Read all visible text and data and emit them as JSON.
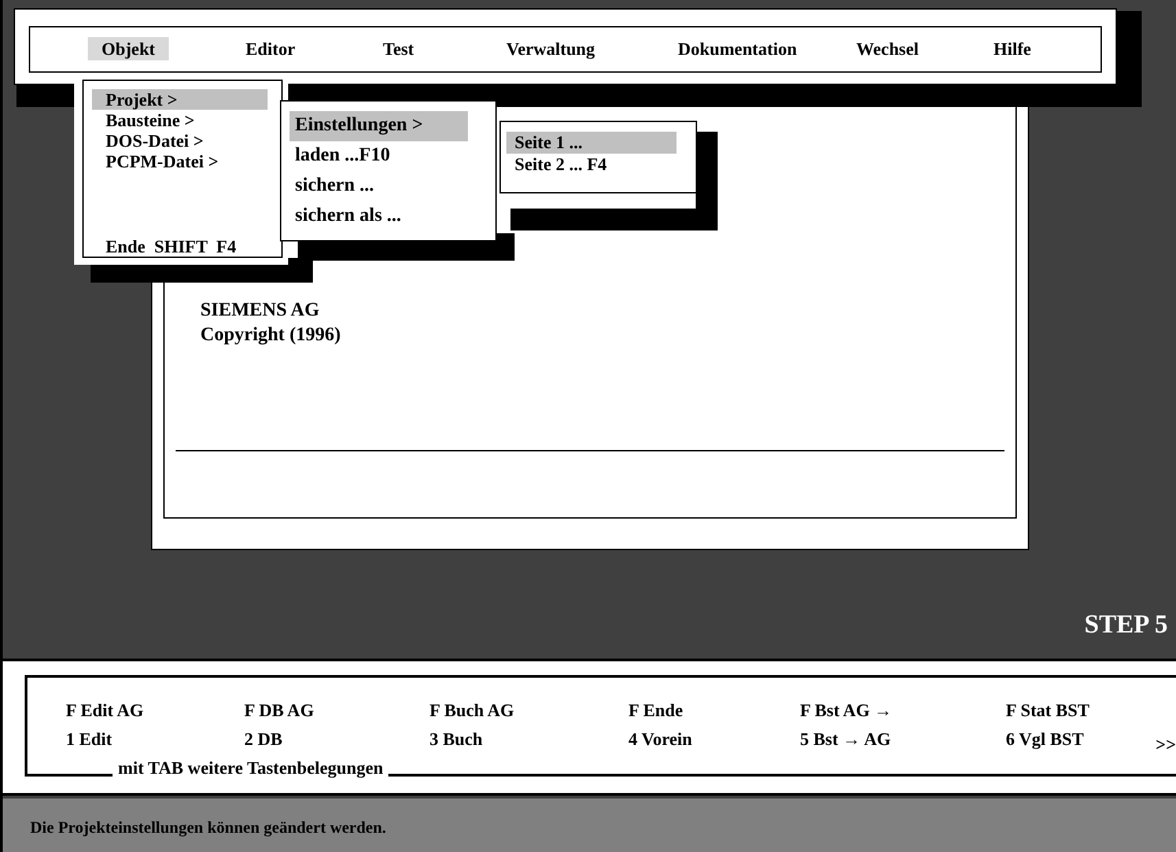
{
  "menu_bar": {
    "items": [
      {
        "label": "Objekt",
        "selected": true
      },
      {
        "label": "Editor",
        "selected": false
      },
      {
        "label": "Test",
        "selected": false
      },
      {
        "label": "Verwaltung",
        "selected": false
      },
      {
        "label": "Dokumentation",
        "selected": false
      },
      {
        "label": "Wechsel",
        "selected": false
      },
      {
        "label": "Hilfe",
        "selected": false
      }
    ]
  },
  "menus": [
    {
      "items": [
        {
          "label": "Projekt >",
          "selected": true
        },
        {
          "label": "Bausteine >",
          "selected": false
        },
        {
          "label": "DOS-Datei >",
          "selected": false
        },
        {
          "label": "PCPM-Datei >",
          "selected": false
        },
        {
          "label": "Ende  SHIFT  F4",
          "selected": false,
          "kind": "bottom"
        }
      ]
    },
    {
      "items": [
        {
          "label": "Einstellungen >",
          "selected": true
        },
        {
          "label": "laden ...F10",
          "selected": false
        },
        {
          "label": "sichern ...",
          "selected": false
        },
        {
          "label": "sichern als ...",
          "selected": false
        }
      ]
    },
    {
      "items": [
        {
          "label": "Seite 1 ...",
          "selected": true
        },
        {
          "label": "Seite 2 ... F4",
          "selected": false
        }
      ]
    }
  ],
  "main_window": {
    "lines": [
      "SIEMENS AG",
      "Copyright (1996)"
    ]
  },
  "product": "STEP 5",
  "function_keys": {
    "keys": [
      {
        "top": "F Edit AG",
        "bottom": "1 Edit"
      },
      {
        "top": "F DB AG",
        "bottom": "2 DB"
      },
      {
        "top": "F Buch AG",
        "bottom": "3 Buch"
      },
      {
        "top": "F Ende",
        "bottom": "4 Vorein"
      },
      {
        "top": "F Bst AG →",
        "bottom": "5 Bst → AG"
      },
      {
        "top": "F Stat BST",
        "bottom": "6 Vgl BST"
      }
    ],
    "more": ">>",
    "legend": "mit TAB weitere Tastenbelegungen"
  },
  "status_bar": "Die Projekteinstellungen können geändert werden."
}
